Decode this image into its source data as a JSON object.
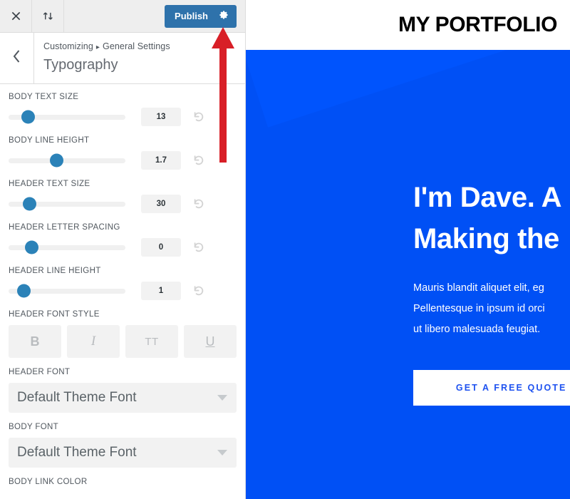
{
  "customizer": {
    "topbar": {
      "close_label": "close-icon",
      "devices_label": "collapse-icon",
      "publish_label": "Publish",
      "publish_gear_label": "gear-icon"
    },
    "header": {
      "back_label": "back-icon",
      "breadcrumb_root": "Customizing",
      "breadcrumb_separator": "▸",
      "breadcrumb_parent": "General Settings",
      "title": "Typography"
    },
    "sliders": [
      {
        "label": "BODY TEXT SIZE",
        "value": "13",
        "percent": 17
      },
      {
        "label": "BODY LINE HEIGHT",
        "value": "1.7",
        "percent": 41
      },
      {
        "label": "HEADER TEXT SIZE",
        "value": "30",
        "percent": 18
      },
      {
        "label": "HEADER LETTER SPACING",
        "value": "0",
        "percent": 20
      },
      {
        "label": "HEADER LINE HEIGHT",
        "value": "1",
        "percent": 13
      }
    ],
    "font_style": {
      "label": "HEADER FONT STYLE",
      "buttons": [
        {
          "name": "bold",
          "glyph": "B"
        },
        {
          "name": "italic",
          "glyph": "I"
        },
        {
          "name": "uppercase",
          "glyph": "TT"
        },
        {
          "name": "underline",
          "glyph": "U"
        }
      ]
    },
    "header_font": {
      "label": "HEADER FONT",
      "value": "Default Theme Font"
    },
    "body_font": {
      "label": "BODY FONT",
      "value": "Default Theme Font"
    },
    "body_link_color": {
      "label": "BODY LINK COLOR"
    },
    "annotation": {
      "arrow_color": "#d81f27",
      "points_to": "publish-gear-button"
    },
    "accent_color": "#2b82b8"
  },
  "preview": {
    "site_title": "MY PORTFOLIO",
    "hero": {
      "background_color": "#0050f5",
      "headline_line1": "I'm Dave. A",
      "headline_line2": "Making the",
      "paragraph_line1": "Mauris blandit aliquet elit, eg",
      "paragraph_line2": "Pellentesque in ipsum id orci",
      "paragraph_line3": "ut libero malesuada feugiat.",
      "cta_label": "GET A FREE QUOTE »",
      "cta_text_color": "#1e52f0"
    }
  }
}
